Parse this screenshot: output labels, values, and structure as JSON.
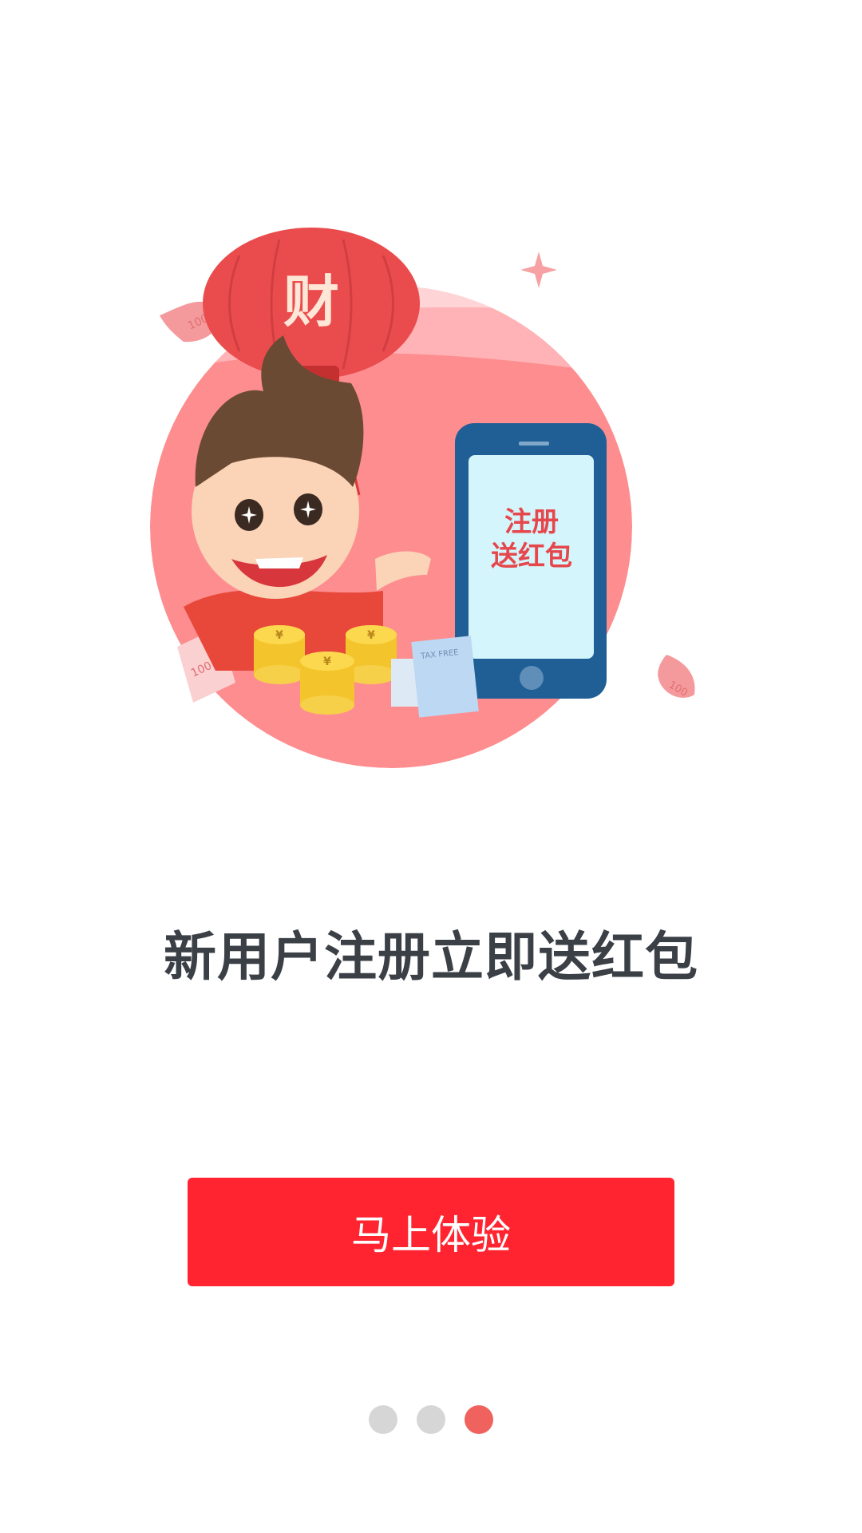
{
  "illustration": {
    "lantern_char": "财",
    "phone_text_line1": "注册",
    "phone_text_line2": "送红包",
    "bill_label": "100",
    "receipt_label": "TAX FREE",
    "coin_symbol": "¥"
  },
  "headline": "新用户注册立即送红包",
  "cta_label": "马上体验",
  "pager": {
    "count": 3,
    "active_index": 2
  },
  "colors": {
    "accent": "#ff2430",
    "headline": "#3b3f46",
    "dot_inactive": "#d6d6d6",
    "dot_active": "#f0625d"
  }
}
